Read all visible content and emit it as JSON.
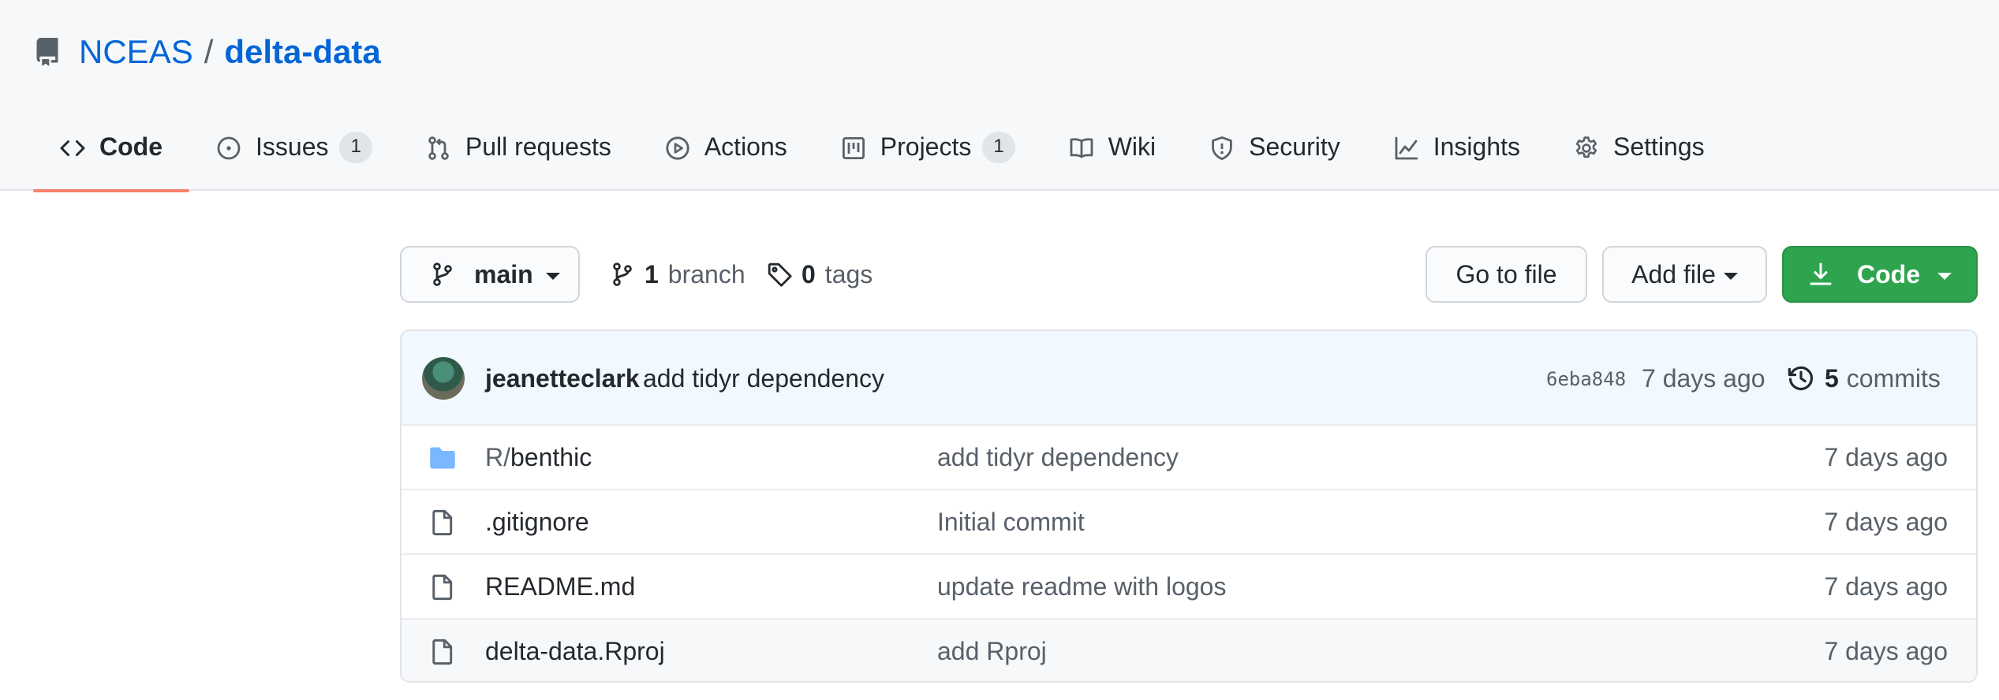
{
  "repo": {
    "owner": "NCEAS",
    "separator": "/",
    "name": "delta-data"
  },
  "tabs": [
    {
      "label": "Code",
      "icon": "code-icon",
      "selected": true
    },
    {
      "label": "Issues",
      "icon": "issue-icon",
      "counter": "1"
    },
    {
      "label": "Pull requests",
      "icon": "pull-request-icon"
    },
    {
      "label": "Actions",
      "icon": "play-icon"
    },
    {
      "label": "Projects",
      "icon": "project-icon",
      "counter": "1"
    },
    {
      "label": "Wiki",
      "icon": "book-icon"
    },
    {
      "label": "Security",
      "icon": "shield-icon"
    },
    {
      "label": "Insights",
      "icon": "graph-icon"
    },
    {
      "label": "Settings",
      "icon": "gear-icon"
    }
  ],
  "toolbar": {
    "branch": "main",
    "branch_count": "1",
    "branch_label": "branch",
    "tag_count": "0",
    "tag_label": "tags",
    "goto_file": "Go to file",
    "add_file": "Add file",
    "code": "Code"
  },
  "commit": {
    "author": "jeanetteclark",
    "message": "add tidyr dependency",
    "sha": "6eba848",
    "age": "7 days ago",
    "count": "5",
    "count_label": "commits"
  },
  "files": [
    {
      "type": "folder",
      "prefix": "R/",
      "name": "benthic",
      "message": "add tidyr dependency",
      "age": "7 days ago"
    },
    {
      "type": "file",
      "prefix": "",
      "name": ".gitignore",
      "message": "Initial commit",
      "age": "7 days ago"
    },
    {
      "type": "file",
      "prefix": "",
      "name": "README.md",
      "message": "update readme with logos",
      "age": "7 days ago"
    },
    {
      "type": "file",
      "prefix": "",
      "name": "delta-data.Rproj",
      "message": "add Rproj",
      "age": "7 days ago"
    }
  ],
  "colors": {
    "link": "#0366d6",
    "tab_underline": "#f9826c",
    "code_button": "#2ea44f",
    "commit_bar": "#f1f8ff",
    "folder": "#79b8ff"
  }
}
